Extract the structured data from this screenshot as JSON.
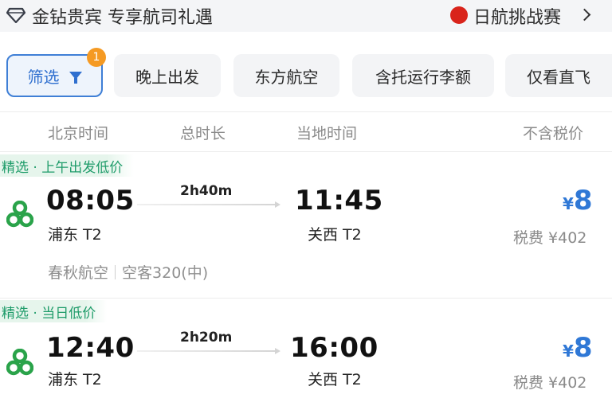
{
  "header": {
    "vip_text": "金钻贵宾  专享航司礼遇",
    "promo_text": "日航挑战赛"
  },
  "filters": {
    "active_label": "筛选",
    "active_count": "1",
    "chips": [
      "晚上出发",
      "东方航空",
      "含托运行李额",
      "仅看直飞"
    ]
  },
  "columns": {
    "beijing_time": "北京时间",
    "duration": "总时长",
    "local_time": "当地时间",
    "price": "不含税价"
  },
  "flights": [
    {
      "tag": "精选 · 上午出发低价",
      "depart_time": "08:05",
      "depart_airport": "浦东 T2",
      "duration": "2h40m",
      "arrive_time": "11:45",
      "arrive_airport": "关西 T2",
      "currency": "¥",
      "price": "8",
      "tax": "税费 ¥402",
      "airline": "春秋航空",
      "aircraft": "空客320(中)"
    },
    {
      "tag": "精选 · 当日低价",
      "depart_time": "12:40",
      "depart_airport": "浦东 T2",
      "duration": "2h20m",
      "arrive_time": "16:00",
      "arrive_airport": "关西 T2",
      "currency": "¥",
      "price": "8",
      "tax": "税费 ¥402"
    }
  ],
  "colors": {
    "accent_blue": "#2f78d6",
    "badge_orange": "#f59a23",
    "tag_green": "#1f9c6a",
    "jal_red": "#d9241b"
  }
}
